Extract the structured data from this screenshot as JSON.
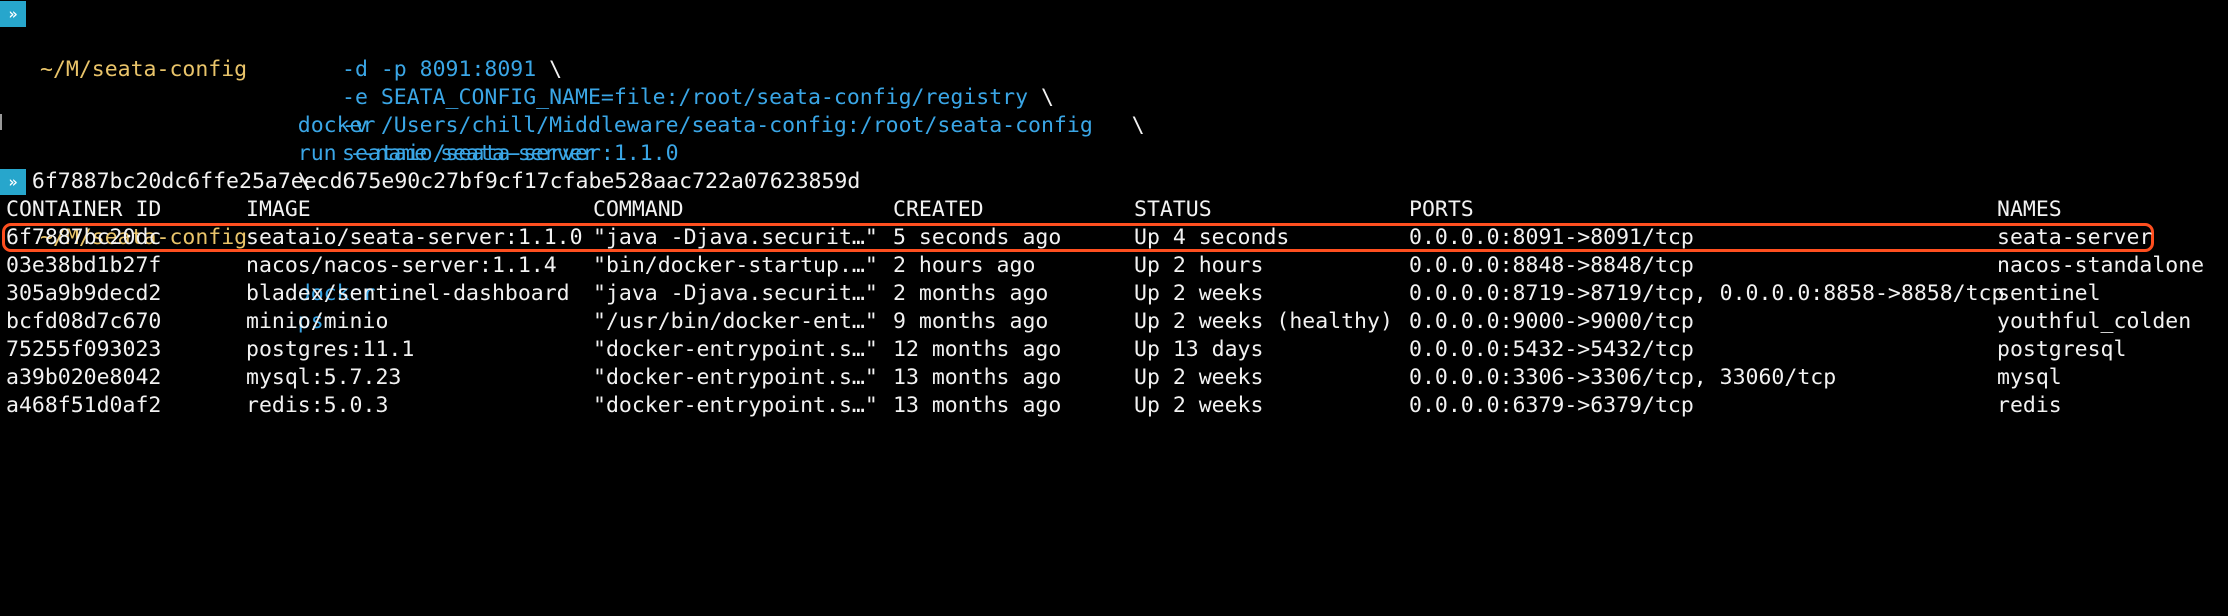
{
  "prompt": {
    "badge": "»",
    "path": "~/M/seata-config"
  },
  "run_command": {
    "cmd": "docker",
    "line1_args": "run --name seata-server",
    "line1_bs": "\\",
    "line2": "-d -p 8091:8091",
    "line2_bs": "\\",
    "line3": "-e SEATA_CONFIG_NAME=file:/root/seata-config/registry",
    "line3_bs": "\\",
    "line4": "-v /Users/chill/Middleware/seata-config:/root/seata-config",
    "line4_bs": "\\",
    "line5": "seataio/seata-server:1.1.0"
  },
  "run_output": "6f7887bc20dc6ffe25a7eecd675e90c27bf9cf17cfabe528aac722a07623859d",
  "ps_command": {
    "cmd": "docker",
    "args": "ps"
  },
  "table": {
    "headers": [
      "CONTAINER ID",
      "IMAGE",
      "COMMAND",
      "CREATED",
      "STATUS",
      "PORTS",
      "NAMES"
    ],
    "rows": [
      [
        "6f7887bc20dc",
        "seataio/seata-server:1.1.0",
        "\"java -Djava.securit…\"",
        "5 seconds ago",
        "Up 4 seconds",
        "0.0.0.0:8091->8091/tcp",
        "seata-server"
      ],
      [
        "03e38bd1b27f",
        "nacos/nacos-server:1.1.4",
        "\"bin/docker-startup.…\"",
        "2 hours ago",
        "Up 2 hours",
        "0.0.0.0:8848->8848/tcp",
        "nacos-standalone"
      ],
      [
        "305a9b9decd2",
        "bladex/sentinel-dashboard",
        "\"java -Djava.securit…\"",
        "2 months ago",
        "Up 2 weeks",
        "0.0.0.0:8719->8719/tcp, 0.0.0.0:8858->8858/tcp",
        "sentinel"
      ],
      [
        "bcfd08d7c670",
        "minio/minio",
        "\"/usr/bin/docker-ent…\"",
        "9 months ago",
        "Up 2 weeks (healthy)",
        "0.0.0.0:9000->9000/tcp",
        "youthful_colden"
      ],
      [
        "75255f093023",
        "postgres:11.1",
        "\"docker-entrypoint.s…\"",
        "12 months ago",
        "Up 13 days",
        "0.0.0.0:5432->5432/tcp",
        "postgresql"
      ],
      [
        "a39b020e8042",
        "mysql:5.7.23",
        "\"docker-entrypoint.s…\"",
        "13 months ago",
        "Up 2 weeks",
        "0.0.0.0:3306->3306/tcp, 33060/tcp",
        "mysql"
      ],
      [
        "a468f51d0af2",
        "redis:5.0.3",
        "\"docker-entrypoint.s…\"",
        "13 months ago",
        "Up 2 weeks",
        "0.0.0.0:6379->6379/tcp",
        "redis"
      ]
    ]
  },
  "colors": {
    "background": "#000000",
    "prompt_badge": "#27a6cc",
    "path": "#e9c46a",
    "command": "#3aa6e6",
    "highlight_border": "#ff4f1f"
  }
}
